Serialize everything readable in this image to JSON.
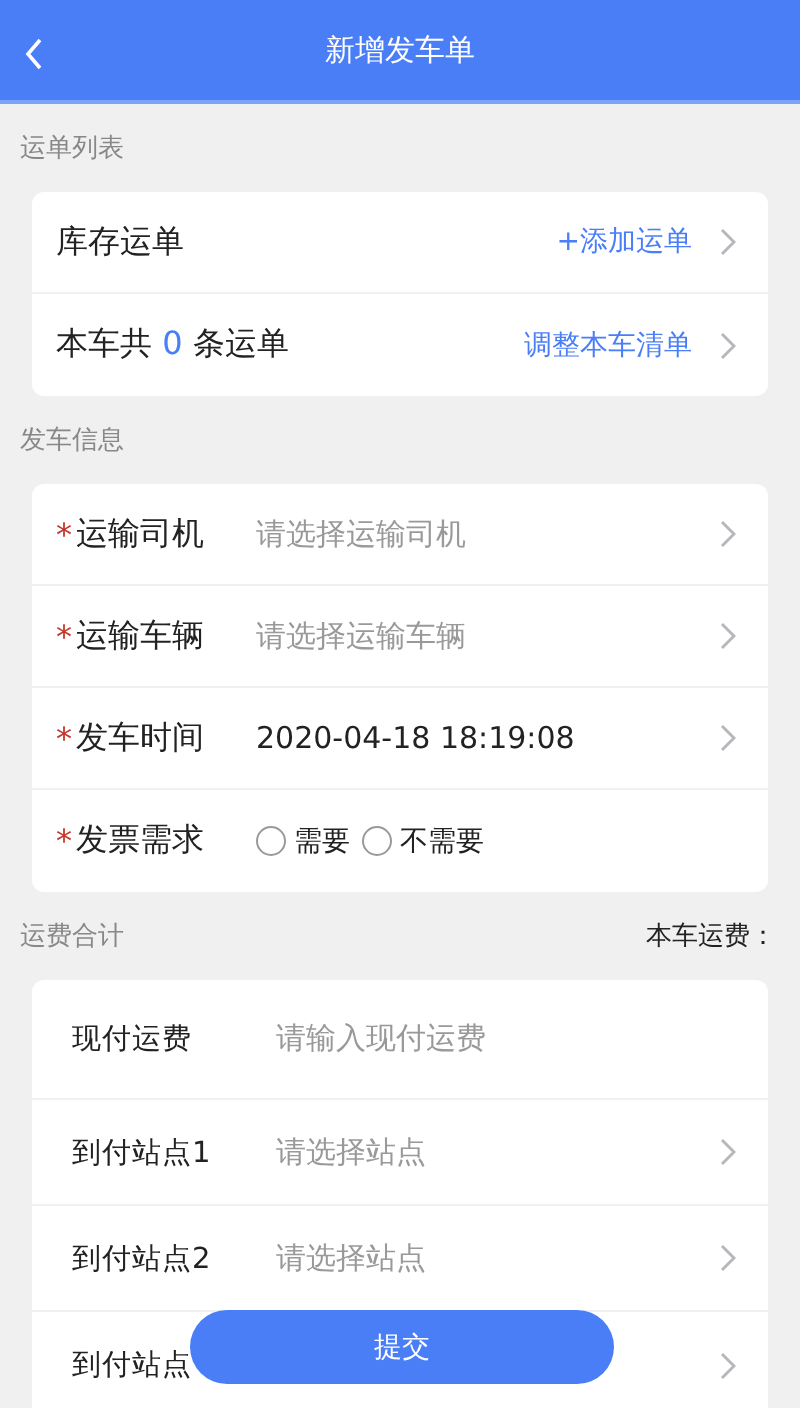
{
  "header": {
    "title": "新增发车单"
  },
  "sections": [
    {
      "title": "运单列表",
      "rows": [
        {
          "kind": "link",
          "label": "库存运单",
          "action": "+添加运单"
        },
        {
          "kind": "count",
          "label_before": "本车共",
          "count": "0",
          "label_after": "条运单",
          "action": "调整本车清单"
        }
      ]
    },
    {
      "title": "发车信息",
      "rows": [
        {
          "kind": "select",
          "required_mark": "*",
          "label": "运输司机",
          "placeholder": "请选择运输司机"
        },
        {
          "kind": "select",
          "required_mark": "*",
          "label": "运输车辆",
          "placeholder": "请选择运输车辆"
        },
        {
          "kind": "select",
          "required_mark": "*",
          "label": "发车时间",
          "value": "2020-04-18 18:19:08"
        },
        {
          "kind": "radio",
          "required_mark": "*",
          "label": "发票需求",
          "options": [
            {
              "label": "需要",
              "selected": false
            },
            {
              "label": "不需要",
              "selected": false
            }
          ]
        }
      ]
    },
    {
      "title": "运费合计",
      "aside": "本车运费：",
      "rows": [
        {
          "kind": "input",
          "label": "现付运费",
          "placeholder": "请输入现付运费"
        },
        {
          "kind": "select",
          "label": "到付站点1",
          "placeholder": "请选择站点"
        },
        {
          "kind": "select",
          "label": "到付站点2",
          "placeholder": "请选择站点"
        },
        {
          "kind": "select",
          "label": "到付站点"
        }
      ]
    }
  ],
  "submit": "提交"
}
